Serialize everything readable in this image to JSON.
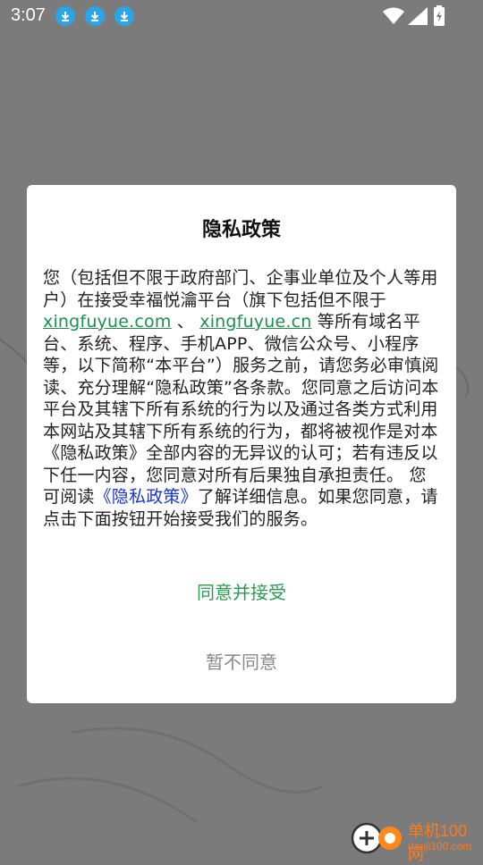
{
  "status_bar": {
    "time": "3:07",
    "icons": [
      "download-icon",
      "download-icon",
      "download-icon",
      "wifi-icon",
      "signal-icon",
      "battery-charging-icon"
    ]
  },
  "dialog": {
    "title": "隐私政策",
    "body": {
      "p1": "您（包括但不限于政府部门、企事业单位及个人等用户）在接受幸福悦瀹平台（旗下包括但不限于 ",
      "link1": "xingfuyue.com",
      "sep": " 、 ",
      "link2": "xingfuyue.cn",
      "p2": " 等所有域名平台、系统、程序、手机APP、微信公众号、小程序等，以下简称“本平台”）服务之前，请您务必审慎阅读、充分理解“隐私政策”各条款。您同意之后访问本平台及其辖下所有系统的行为以及通过各类方式利用本网站及其辖下所有系统的行为，都将被视作是对本《隐私政策》全部内容的无异议的认可；若有违反以下任一内容，您同意对所有后果独自承担责任。 您可阅读",
      "link3": "《隐私政策》",
      "p3": "了解详细信息。如果您同意，请点击下面按钮开始接受我们的服务。"
    },
    "accept_label": "同意并接受",
    "reject_label": "暂不同意"
  },
  "watermark": {
    "brand": "单机100网",
    "url": "danji100.com"
  },
  "colors": {
    "accent_green": "#2b9a52",
    "link_blue": "#1a35d6",
    "overlay": "#7b7b7b"
  }
}
